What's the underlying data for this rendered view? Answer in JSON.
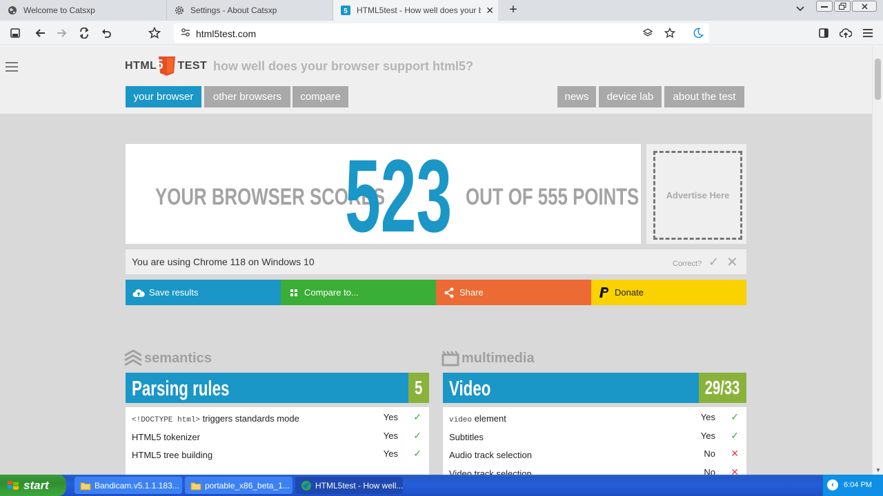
{
  "browser": {
    "tabs": [
      {
        "title": "Welcome to Catsxp",
        "icon": "globe-icon"
      },
      {
        "title": "Settings - About Catsxp",
        "icon": "gear-icon"
      },
      {
        "title": "HTML5test - How well does your bro",
        "icon": "html5-icon"
      }
    ],
    "new_tab": "+",
    "tab_close": "✕",
    "url": "html5test.com"
  },
  "site": {
    "logo_left": "HTML",
    "logo_num": "5",
    "logo_right": "TEST",
    "tagline": "how well does your browser support html5?",
    "nav_left": [
      "your browser",
      "other browsers",
      "compare"
    ],
    "nav_right": [
      "news",
      "device lab",
      "about the test"
    ]
  },
  "score": {
    "prefix": "YOUR BROWSER SCORES",
    "value": "523",
    "suffix": "OUT OF 555 POINTS",
    "ad": "Advertise Here"
  },
  "ua": {
    "text": "You are using Chrome 118 on Windows 10",
    "correct": "Correct?"
  },
  "actions": [
    "Save results",
    "Compare to...",
    "Share",
    "Donate"
  ],
  "sections": {
    "left": {
      "name": "semantics",
      "category": "Parsing rules",
      "score": "5",
      "rows": [
        {
          "code": "<!DOCTYPE html>",
          "label": " triggers standards mode",
          "result": "Yes",
          "pass": true
        },
        {
          "code": "",
          "label": "HTML5 tokenizer",
          "result": "Yes",
          "pass": true
        },
        {
          "code": "",
          "label": "HTML5 tree building",
          "result": "Yes",
          "pass": true
        }
      ]
    },
    "right": {
      "name": "multimedia",
      "category": "Video",
      "score": "29/33",
      "rows": [
        {
          "code": "video",
          "label": " element",
          "result": "Yes",
          "pass": true
        },
        {
          "code": "",
          "label": "Subtitles",
          "result": "Yes",
          "pass": true
        },
        {
          "code": "",
          "label": "Audio track selection",
          "result": "No",
          "pass": false
        },
        {
          "code": "",
          "label": "Video track selection",
          "result": "No",
          "pass": false
        }
      ]
    }
  },
  "taskbar": {
    "start": "start",
    "tasks": [
      "Bandicam.v5.1.1.183...",
      "portable_x86_beta_1...",
      "HTML5test - How well..."
    ],
    "clock": "6:04 PM"
  },
  "colors": {
    "accent": "#1a96c7",
    "green": "#3aae36",
    "orange": "#ec6a34",
    "yellow": "#f9d200",
    "score_green": "#8ab23a"
  }
}
